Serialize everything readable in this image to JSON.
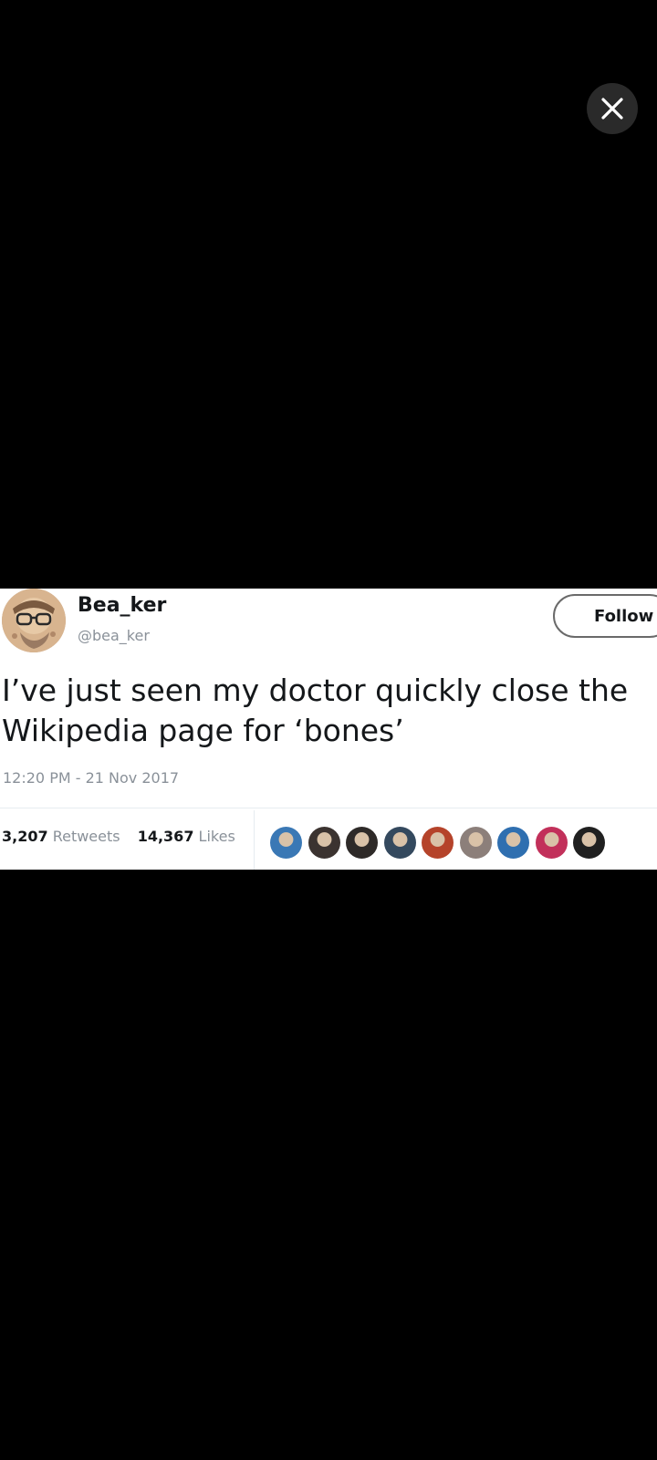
{
  "viewer": {
    "close_icon": "close-icon"
  },
  "tweet": {
    "display_name": "Bea_ker",
    "handle": "@bea_ker",
    "follow_label": "Follow",
    "text_lines": [
      "I’ve just seen my doctor quickly close the",
      "Wikipedia page for ‘bones’"
    ],
    "timestamp": "12:20 PM - 21 Nov 2017",
    "retweets_count": "3,207",
    "retweets_label": "Retweets",
    "likes_count": "14,367",
    "likes_label": "Likes",
    "liker_avatar_colors": [
      "#3a78b5",
      "#3b3330",
      "#2e2a28",
      "#34495e",
      "#b5432a",
      "#8c7f7a",
      "#2f6fb0",
      "#c2305a",
      "#202020"
    ]
  },
  "colors": {
    "background": "#000000",
    "card": "#ffffff",
    "muted_text": "#8a9199",
    "primary_text": "#14171a"
  }
}
